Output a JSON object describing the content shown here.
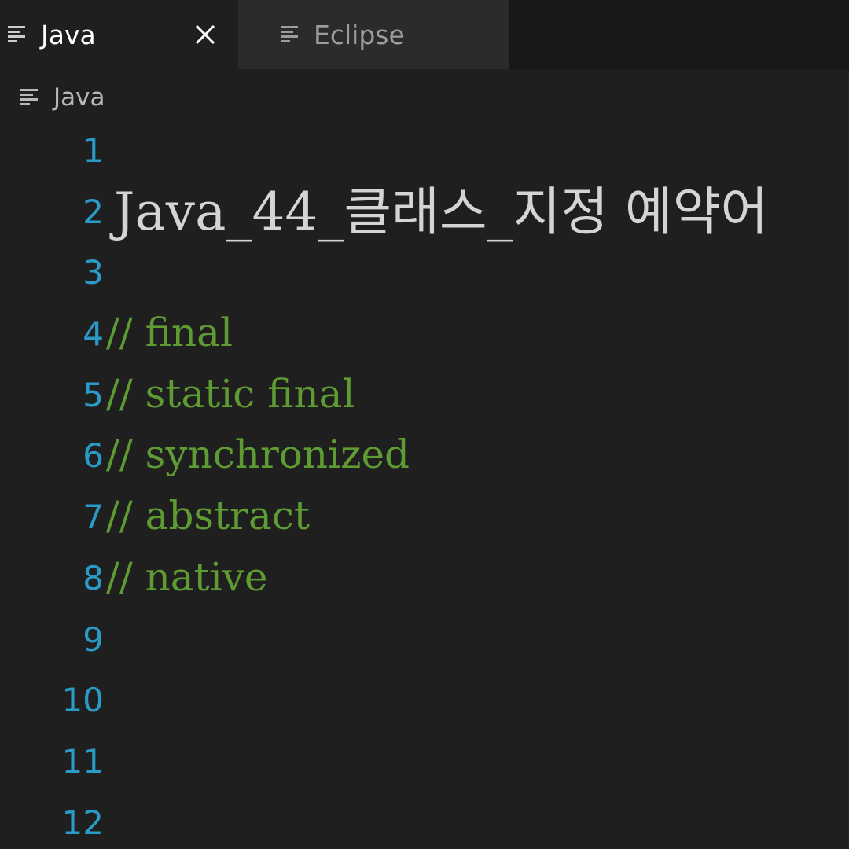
{
  "tabs": [
    {
      "label": "Java",
      "active": true
    },
    {
      "label": "Eclipse",
      "active": false
    }
  ],
  "breadcrumb": {
    "label": "Java"
  },
  "editor": {
    "lines": [
      {
        "number": "1",
        "text": ""
      },
      {
        "number": "2",
        "text": "Java_44_클래스_지정 예약어"
      },
      {
        "number": "3",
        "text": ""
      },
      {
        "number": "4",
        "text": "// final"
      },
      {
        "number": "5",
        "text": "// static final"
      },
      {
        "number": "6",
        "text": "// synchronized"
      },
      {
        "number": "7",
        "text": "// abstract"
      },
      {
        "number": "8",
        "text": "// native"
      },
      {
        "number": "9",
        "text": ""
      },
      {
        "number": "10",
        "text": ""
      },
      {
        "number": "11",
        "text": ""
      },
      {
        "number": "12",
        "text": ""
      }
    ]
  },
  "colors": {
    "background": "#1f1f1f",
    "line_number": "#2a9bc7",
    "comment": "#5f9b33",
    "heading_text": "#d4d4d4"
  },
  "icons": {
    "tab_file_icon": "lines-icon",
    "close_icon": "close-icon"
  }
}
